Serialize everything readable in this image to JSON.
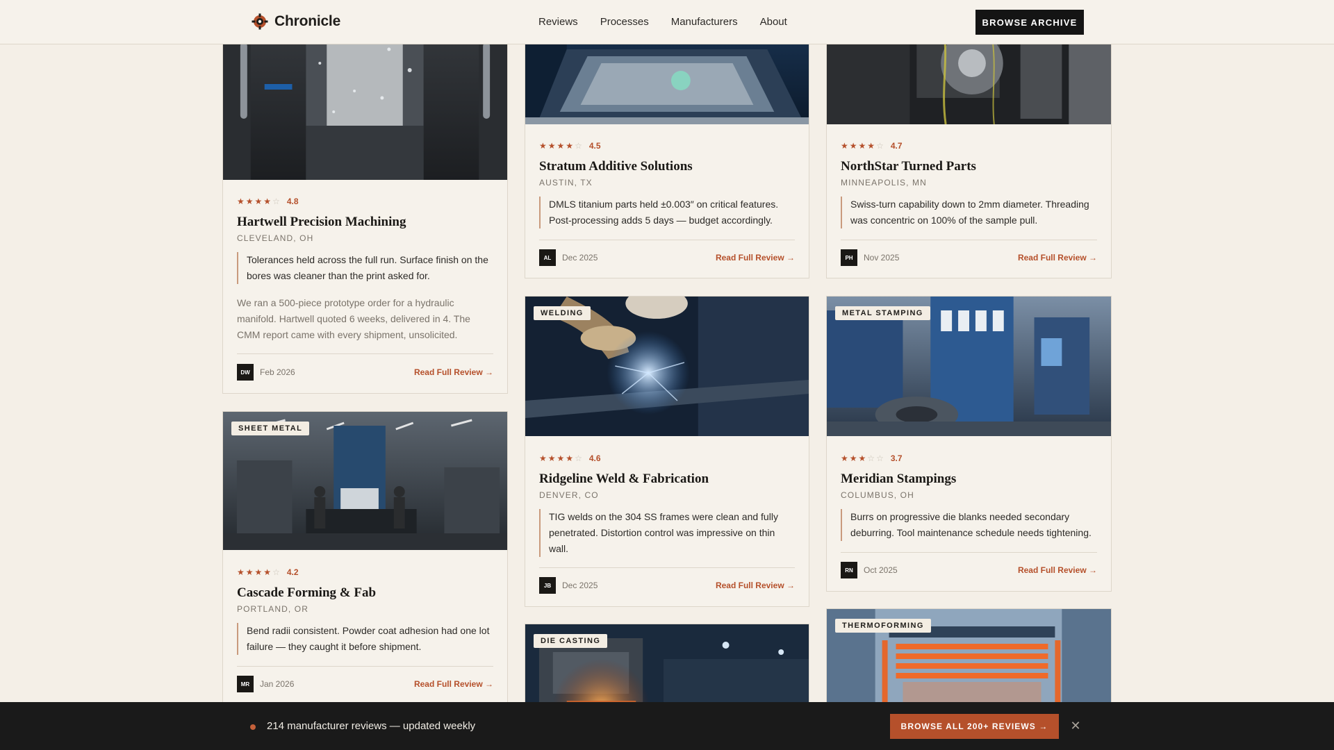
{
  "header": {
    "brand": "Chronicle",
    "nav": [
      "Reviews",
      "Processes",
      "Manufacturers",
      "About"
    ],
    "cta": "BROWSE ARCHIVE"
  },
  "cards": [
    {
      "rating": "4.8",
      "stars": 4,
      "title": "Hartwell Precision Machining",
      "location": "CLEVELAND, OH",
      "quote": "Tolerances held across the full run. Surface finish on the bores was cleaner than the print asked for.",
      "body": "We ran a 500-piece prototype order for a hydraulic manifold. Hartwell quoted 6 weeks, delivered in 4. The CMM report came with every shipment, unsolicited.",
      "initials": "DW",
      "date": "Feb 2026",
      "link": "Read Full Review"
    },
    {
      "rating": "4.5",
      "stars": 4,
      "title": "Stratum Additive Solutions",
      "location": "AUSTIN, TX",
      "quote": "DMLS titanium parts held ±0.003″ on critical features. Post-processing adds 5 days — budget accordingly.",
      "initials": "AL",
      "date": "Dec 2025",
      "link": "Read Full Review"
    },
    {
      "rating": "4.7",
      "stars": 4,
      "title": "NorthStar Turned Parts",
      "location": "MINNEAPOLIS, MN",
      "quote": "Swiss-turn capability down to 2mm diameter. Threading was concentric on 100% of the sample pull.",
      "initials": "PH",
      "date": "Nov 2025",
      "link": "Read Full Review"
    },
    {
      "tag": "SHEET METAL",
      "rating": "4.2",
      "stars": 4,
      "title": "Cascade Forming & Fab",
      "location": "PORTLAND, OR",
      "quote": "Bend radii consistent. Powder coat adhesion had one lot failure — they caught it before shipment.",
      "initials": "MR",
      "date": "Jan 2026",
      "link": "Read Full Review"
    },
    {
      "tag": "WELDING",
      "rating": "4.6",
      "stars": 4,
      "title": "Ridgeline Weld & Fabrication",
      "location": "DENVER, CO",
      "quote": "TIG welds on the 304 SS frames were clean and fully penetrated. Distortion control was impressive on thin wall.",
      "initials": "JB",
      "date": "Dec 2025",
      "link": "Read Full Review"
    },
    {
      "tag": "METAL STAMPING",
      "rating": "3.7",
      "stars": 3,
      "title": "Meridian Stampings",
      "location": "COLUMBUS, OH",
      "quote": "Burrs on progressive die blanks needed secondary deburring. Tool maintenance schedule needs tightening.",
      "initials": "RN",
      "date": "Oct 2025",
      "link": "Read Full Review"
    },
    {
      "tag": "DIE CASTING"
    },
    {
      "tag": "THERMOFORMING"
    }
  ],
  "bottom_bar": {
    "text": "214 manufacturer reviews — updated weekly",
    "cta": "BROWSE ALL 200+ REVIEWS"
  },
  "colors": {
    "accent": "#b5502b",
    "dark": "#1a1a1a",
    "background": "#f4efe7"
  }
}
